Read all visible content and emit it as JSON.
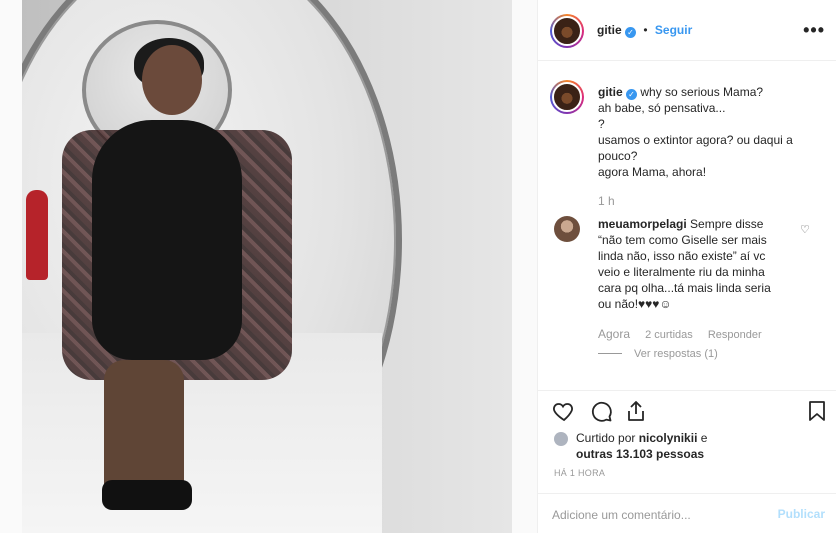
{
  "post": {
    "username": "gitie",
    "follow_label": "Seguir",
    "dot": "•",
    "more": "•••",
    "verified_mark": "✓"
  },
  "caption": {
    "username": "gitie",
    "lines": [
      "why so serious Mama?",
      "ah babe, só pensativa...",
      "?",
      "usamos o extintor agora? ou daqui a",
      "pouco?",
      "agora Mama, ahora!"
    ],
    "time": "1 h"
  },
  "comment": {
    "username": "meuamorpelagi",
    "text_lines": [
      "Sempre disse",
      "“não tem como Giselle ser mais",
      "linda não, isso não existe” aí vc",
      "veio e literalmente riu da minha",
      "cara pq olha...tá mais linda seria",
      "ou não!♥♥♥☺"
    ],
    "time": "Agora",
    "likes": "2 curtidas",
    "reply": "Responder",
    "view_replies": "Ver respostas (1)"
  },
  "likes": {
    "prefix": "Curtido por",
    "user": "nicolynikii",
    "mid": "e",
    "others": "outras 13.103 pessoas"
  },
  "ago": "HÁ 1 HORA",
  "comment_box": {
    "placeholder": "Adicione um comentário...",
    "publish": "Publicar"
  },
  "icons": {
    "heart": "heart-icon",
    "comment": "comment-icon",
    "share": "share-icon",
    "bookmark": "bookmark-icon",
    "more": "more-icon"
  },
  "colors": {
    "link": "#3897f0",
    "publish_disabled": "#b2dffc",
    "muted": "#999999"
  }
}
